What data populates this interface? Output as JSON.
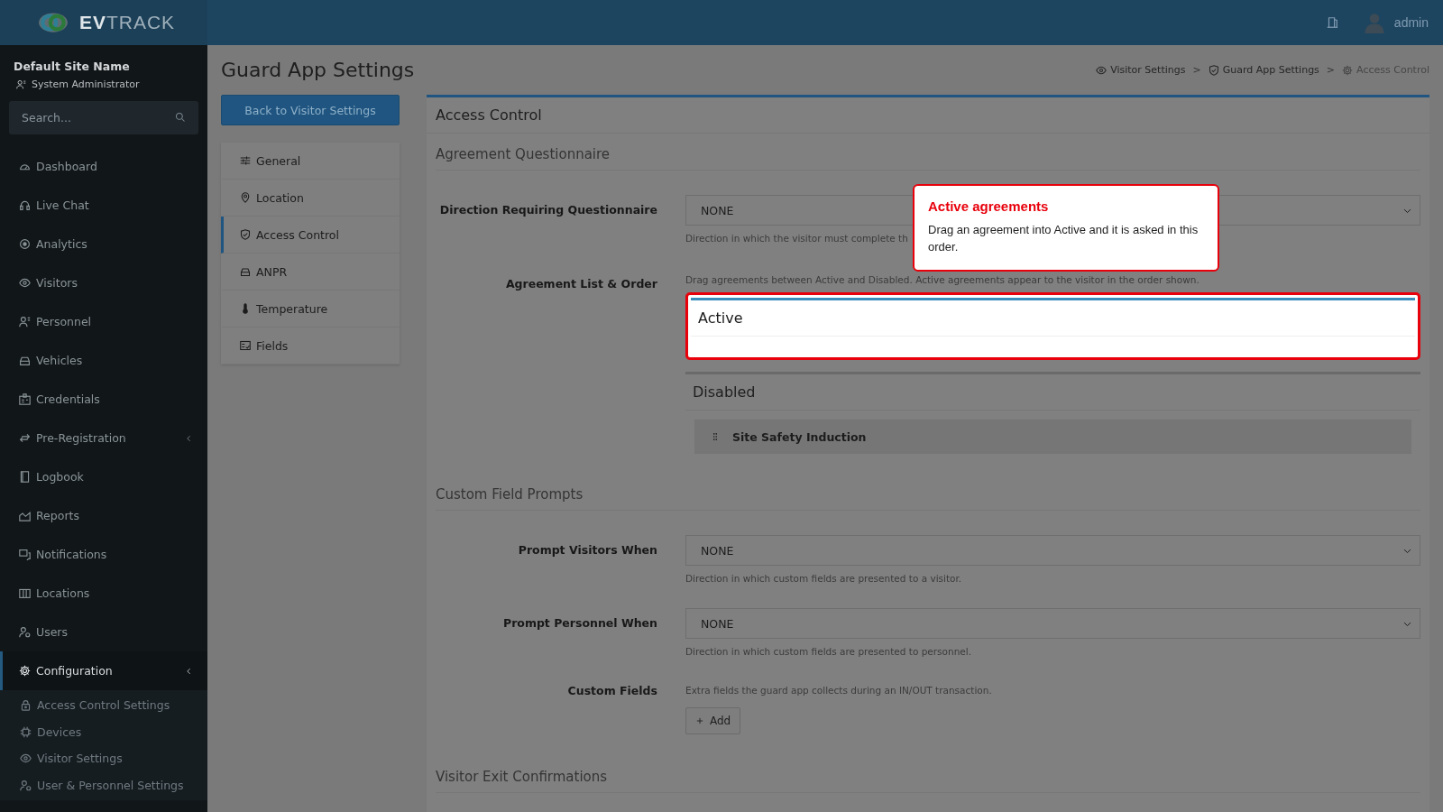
{
  "header": {
    "logo": "**EV**TRACK",
    "user": "admin"
  },
  "sidebar": {
    "site": "Default Site Name",
    "role": "System Administrator",
    "search": {
      "placeholder": "Search..."
    },
    "items": [
      {
        "label": "Dashboard",
        "selected": false,
        "submenu": false
      },
      {
        "label": "Live Chat",
        "selected": false,
        "submenu": false
      },
      {
        "label": "Analytics",
        "selected": false,
        "submenu": false
      },
      {
        "label": "Visitors",
        "selected": false,
        "submenu": false
      },
      {
        "label": "Personnel",
        "selected": false,
        "submenu": false
      },
      {
        "label": "Vehicles",
        "selected": false,
        "submenu": false
      },
      {
        "label": "Credentials",
        "selected": false,
        "submenu": false
      },
      {
        "label": "Pre-Registration",
        "selected": false,
        "submenu": true
      },
      {
        "label": "Logbook",
        "selected": false,
        "submenu": false
      },
      {
        "label": "Reports",
        "selected": false,
        "submenu": false
      },
      {
        "label": "Notifications",
        "selected": false,
        "submenu": false
      },
      {
        "label": "Locations",
        "selected": false,
        "submenu": false
      },
      {
        "label": "Users",
        "selected": false,
        "submenu": false
      },
      {
        "label": "Configuration",
        "selected": true,
        "submenu": true,
        "children": [
          {
            "label": "Access Control Settings"
          },
          {
            "label": "Devices"
          },
          {
            "label": "Visitor Settings"
          },
          {
            "label": "User & Personnel Settings"
          }
        ]
      }
    ]
  },
  "page": {
    "title": "Guard App Settings",
    "back_button": "Back to Visitor Settings",
    "breadcrumb": {
      "items": [
        "Visitor Settings",
        "Guard App Settings",
        "Access Control"
      ],
      "separators": [
        ">",
        ">"
      ]
    },
    "settings_nav": [
      {
        "label": "General",
        "selected": false
      },
      {
        "label": "Location",
        "selected": false
      },
      {
        "label": "Access Control",
        "selected": true
      },
      {
        "label": "ANPR",
        "selected": false
      },
      {
        "label": "Temperature",
        "selected": false
      },
      {
        "label": "Fields",
        "selected": false
      }
    ]
  },
  "panel": {
    "title": "Access Control",
    "sections": [
      {
        "heading": "Agreement Questionnaire",
        "rows": [
          {
            "kind": "select",
            "label": "Direction Requiring Questionnaire",
            "value": "NONE",
            "help": "Direction in which the visitor must complete th"
          },
          {
            "kind": "agreements",
            "label": "Agreement List & Order",
            "help": "Drag agreements between Active and Disabled. Active agreements appear to the visitor in the order shown.",
            "active": {
              "title": "Active"
            },
            "disabled": {
              "title": "Disabled",
              "items": [
                "Site Safety Induction"
              ]
            }
          }
        ]
      },
      {
        "heading": "Custom Field Prompts",
        "rows": [
          {
            "kind": "select",
            "label": "Prompt Visitors When",
            "value": "NONE",
            "help": "Direction in which custom fields are presented to a visitor."
          },
          {
            "kind": "select",
            "label": "Prompt Personnel When",
            "value": "NONE",
            "help": "Direction in which custom fields are presented to personnel."
          },
          {
            "kind": "button",
            "label": "Custom Fields",
            "help": "Extra fields the guard app collects during an IN/OUT transaction.",
            "button": "Add"
          }
        ]
      },
      {
        "heading": "Visitor Exit Confirmations"
      }
    ]
  },
  "tooltip": {
    "title": "Active agreements",
    "body": "Drag an agreement into Active and it is asked in this order."
  }
}
